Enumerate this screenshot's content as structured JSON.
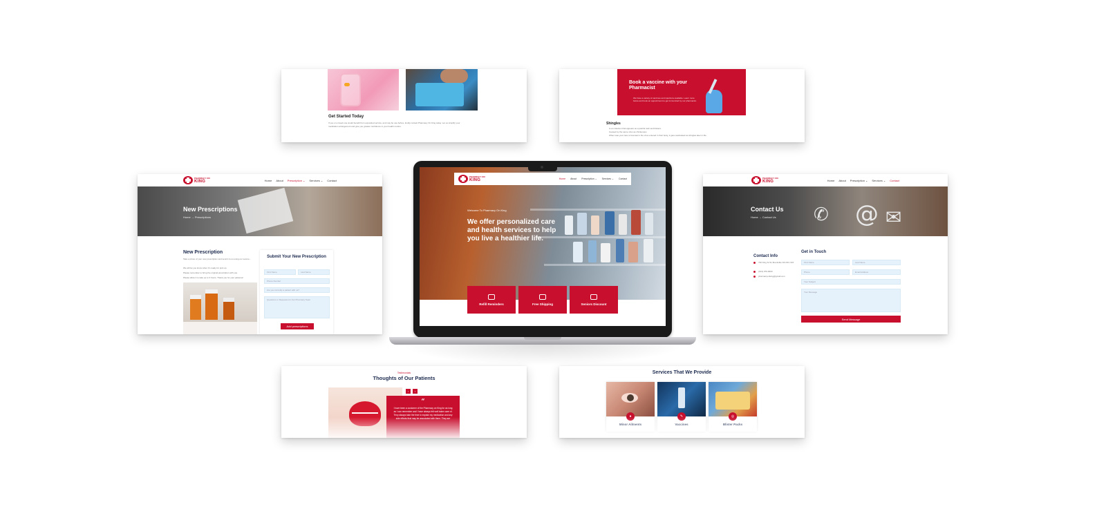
{
  "brand": {
    "logo_small": "PHARMACY ON",
    "logo_big": "KING",
    "accent": "#c8102e"
  },
  "nav": {
    "home": "Home",
    "about": "About",
    "prescription": "Prescription ⌄",
    "services": "Services ⌄",
    "contact": "Contact"
  },
  "top_left": {
    "heading": "Get Started Today",
    "body1": "If you or a loved one would benefit from expanded service, and may be use before, kindly contact Pharmacy On King today. Let us simplify your",
    "body2": "medication arrangement and give you greater confidence in your health routine."
  },
  "top_right": {
    "banner_title": "Book a vaccine with your Pharmacist",
    "banner_text": "We have a variety of vaccines and injections available. Learn more below and book an appointment to get immunized by our pharmacist.",
    "heading": "Shingles",
    "b1": "Is an infection that appears as a painful rash and blisters.",
    "b2": "Caused by the same virus as chickenpox.",
    "b3": "When was your care is forecast in the virus entered in their body, it gets reactivated as shingles later in life."
  },
  "mid_left": {
    "hero_title": "New Prescriptions",
    "crumb": "Home  →  Prescriptions",
    "heading": "New Prescription",
    "p1": "Take a photo of your new prescription and send it to us using our secure...",
    "p2": "We will let you know when it's ready for pick up.",
    "p3": "Please remember to bring the original prescription with you.",
    "p4": "Please allow 4 to take up to 3 hours. Thank you for your patience!",
    "form_title": "Submit Your New Prescription",
    "first_name": "First Name",
    "last_name": "Last Name",
    "phone": "Phone Number",
    "contacted": "Are you currently a patient with us?",
    "message": "Questions or Requests for Our Pharmacy Team",
    "submit": "Add prescriptions"
  },
  "laptop": {
    "welcome": "Welcome To Pharmacy On King",
    "headline": "We offer personalized care and health services to help you live a healthier life.",
    "tiles": [
      "Refill Reminders",
      "Free Shipping",
      "Seniors Discount"
    ]
  },
  "mid_right": {
    "hero_title": "Contact Us",
    "crumb": "Home  →  Contact Us",
    "info_heading": "Contact Info",
    "address": "730 King St W, Brockville ON K6V 3L5",
    "phone": "(613) 979-0000",
    "email": "pharmacyonking@gmail.com",
    "form_heading": "Get in Touch",
    "first_name": "First Name",
    "last_name": "Last Name",
    "phone_field": "Phone",
    "email_field": "Email Address",
    "subject": "Your Subject",
    "message": "Your Message",
    "send": "Send Message"
  },
  "bottom_left": {
    "kicker": "Testimonials",
    "heading": "Thoughts of Our Patients",
    "quote": "I have been a customer of the Pharmacy on King for as long as I can remember and I have always felt well taken care of. They always take the time to explain my medication and any side effects that may be associated with them. They are"
  },
  "bottom_right": {
    "heading": "Services That We Provide",
    "services": [
      "Minor Ailments",
      "Vaccines",
      "Blister Packs"
    ]
  }
}
